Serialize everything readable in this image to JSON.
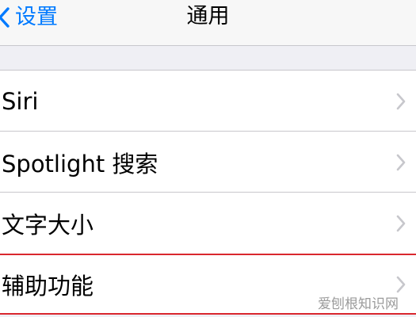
{
  "navbar": {
    "back_label": "设置",
    "title": "通用",
    "back_icon": "chevron-left-icon"
  },
  "list": {
    "items": [
      {
        "label": "Siri",
        "icon": "chevron-right-icon"
      },
      {
        "label": "Spotlight 搜索",
        "icon": "chevron-right-icon"
      },
      {
        "label": "文字大小",
        "icon": "chevron-right-icon"
      },
      {
        "label": "辅助功能",
        "icon": "chevron-right-icon",
        "highlighted": true
      }
    ]
  },
  "watermark": "爱刨根知识网",
  "colors": {
    "accent": "#007aff",
    "highlight_border": "#d9272e",
    "background": "#efeff4",
    "separator": "#c8c7cc",
    "chevron": "#c7c7cc"
  }
}
